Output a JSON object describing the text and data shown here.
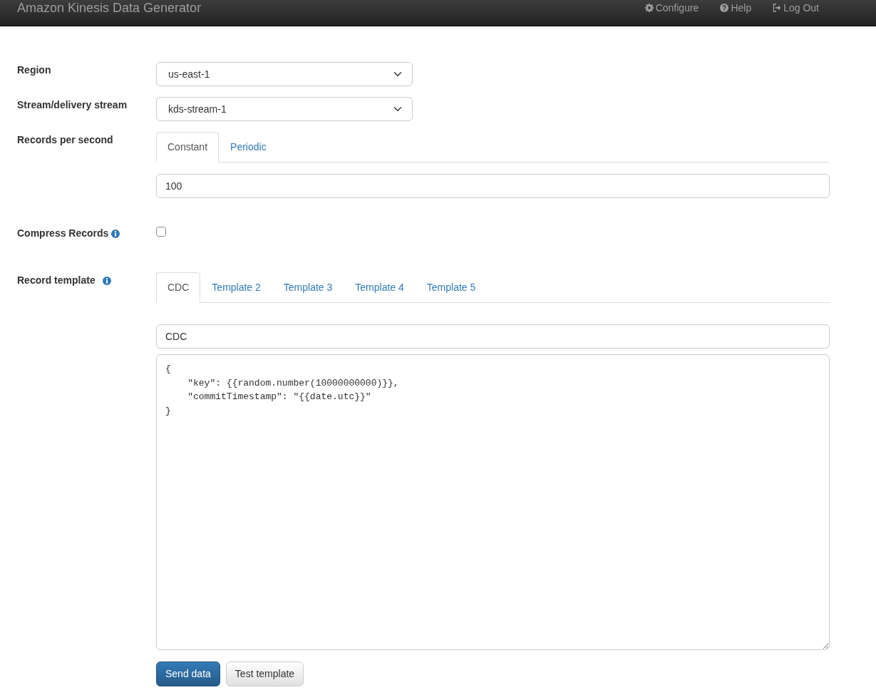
{
  "navbar": {
    "brand": "Amazon Kinesis Data Generator",
    "links": [
      {
        "kind": "configure",
        "label": "Configure"
      },
      {
        "kind": "help",
        "label": "Help"
      },
      {
        "kind": "logout",
        "label": "Log Out"
      }
    ]
  },
  "region": {
    "label": "Region",
    "value": "us-east-1"
  },
  "stream": {
    "label": "Stream/delivery stream",
    "value": "kds-stream-1"
  },
  "records_per_second": {
    "label": "Records per second",
    "tabs": [
      {
        "label": "Constant",
        "selected": true
      },
      {
        "label": "Periodic",
        "selected": false
      }
    ],
    "value": "100"
  },
  "compress": {
    "label": "Compress Records",
    "checked": false
  },
  "record_template": {
    "label": "Record template",
    "tabs": [
      {
        "label": "CDC",
        "selected": true
      },
      {
        "label": "Template 2",
        "selected": false
      },
      {
        "label": "Template 3",
        "selected": false
      },
      {
        "label": "Template 4",
        "selected": false
      },
      {
        "label": "Template 5",
        "selected": false
      }
    ],
    "name": "CDC",
    "body": "{\n    \"key\": {{random.number(10000000000)}},\n    \"commitTimestamp\": \"{{date.utc}}\"\n}"
  },
  "buttons": [
    {
      "kind": "primary",
      "label": "Send data"
    },
    {
      "kind": "secondary",
      "label": "Test template"
    }
  ]
}
